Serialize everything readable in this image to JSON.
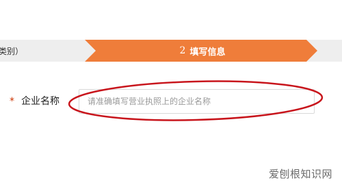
{
  "steps": {
    "previous_label": "类别）",
    "current_number": "2",
    "current_label": "填写信息"
  },
  "form": {
    "required_mark": "*",
    "company_name_label": "企业名称",
    "company_name_value": "",
    "company_name_placeholder": "请准确填写营业执照上的企业名称"
  },
  "watermark": "爱刨根知识网",
  "colors": {
    "step_active": "#ef7d3a",
    "step_inactive": "#eeeeee",
    "required": "#cc3300",
    "annotation": "#c8151c"
  }
}
